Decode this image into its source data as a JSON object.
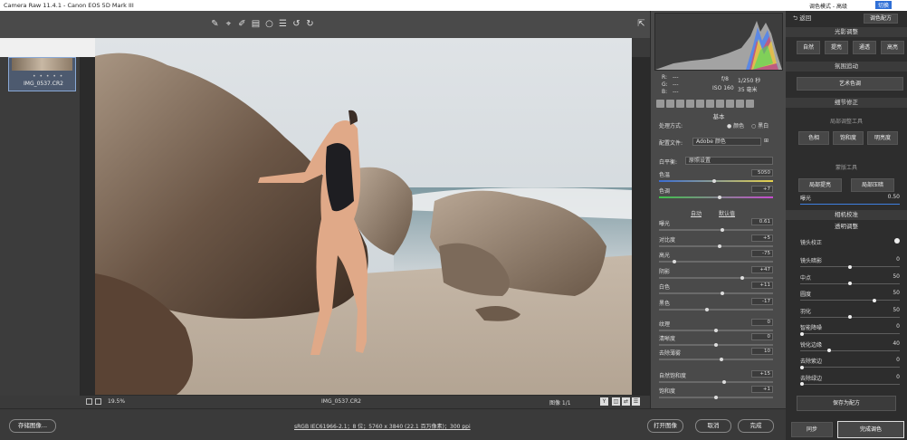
{
  "app": {
    "title": "Camera Raw 11.4.1 - Canon EOS 5D Mark III"
  },
  "filmstrip": {
    "thumb_name": "IMG_0537.CR2",
    "stars": "• • • • •"
  },
  "canvas": {
    "zoom": "19.5%",
    "filename": "IMG_0537.CR2",
    "image_count": "图像 1/1"
  },
  "bottom": {
    "save_label": "存储图像...",
    "workflow_link": "sRGB IEC61966-2.1；8 位；5760 x 3840 (22.1 百万像素)；300 ppi",
    "open_label": "打开图像",
    "cancel_label": "取消",
    "done_label": "完成"
  },
  "exif": {
    "r": "R:",
    "g": "G:",
    "b": "B:",
    "dash": "---",
    "aperture": "f/8",
    "shutter": "1/250 秒",
    "iso": "ISO 160",
    "focal": "35 毫米"
  },
  "basic": {
    "title": "基本",
    "treatment_label": "处理方式:",
    "color_label": "颜色",
    "bw_label": "黑白",
    "profile_label": "配置文件:",
    "profile_value": "Adobe 颜色",
    "wb_label": "白平衡:",
    "wb_value": "原照设置",
    "temp_label": "色温",
    "temp_value": "5050",
    "temp_pos": 0.48,
    "tint_label": "色调",
    "tint_value": "+7",
    "tint_pos": 0.53,
    "auto_label": "自动",
    "default_label": "默认值",
    "sliders": [
      {
        "label": "曝光",
        "value": "0.61",
        "pos": 0.56
      },
      {
        "label": "对比度",
        "value": "+5",
        "pos": 0.53
      },
      {
        "label": "高光",
        "value": "-75",
        "pos": 0.12
      },
      {
        "label": "阴影",
        "value": "+47",
        "pos": 0.74
      },
      {
        "label": "白色",
        "value": "+11",
        "pos": 0.56
      },
      {
        "label": "黑色",
        "value": "-17",
        "pos": 0.42
      }
    ],
    "presence": [
      {
        "label": "纹理",
        "value": "0",
        "pos": 0.5
      },
      {
        "label": "清晰度",
        "value": "0",
        "pos": 0.5
      },
      {
        "label": "去除薄雾",
        "value": "10",
        "pos": 0.55
      }
    ],
    "sat": [
      {
        "label": "自然饱和度",
        "value": "+15",
        "pos": 0.57
      },
      {
        "label": "饱和度",
        "value": "+1",
        "pos": 0.5
      }
    ]
  },
  "plugin": {
    "top_title": "调色模式 - 高级",
    "top_badge": "切换",
    "back_label": "返回",
    "config_label": "调色配方",
    "sec1": "光影调整",
    "sec1_buttons": [
      "自然",
      "提亮",
      "通透",
      "高亮"
    ],
    "sec2": "氛围追动",
    "art_label": "艺术色调",
    "sec3": "细节修正",
    "local_label": "局部调整工具",
    "local_buttons": [
      "色相",
      "饱和度",
      "明亮度"
    ],
    "mask_label": "蒙版工具",
    "mask_buttons": [
      "局部提亮",
      "局部压暗"
    ],
    "exposure_label": "曝光",
    "exposure_value": "0.50",
    "sec4": "相机校准",
    "sec5": "透明调整",
    "lens_label": "镜头校正",
    "rows": [
      {
        "label": "镜头暗影",
        "value": "0",
        "pos": 0.5
      },
      {
        "label": "中点",
        "value": "50",
        "pos": 0.5
      },
      {
        "label": "圆度",
        "value": "50",
        "pos": 0.75
      },
      {
        "label": "羽化",
        "value": "50",
        "pos": 0.5
      },
      {
        "label": "智能降噪",
        "value": "0",
        "pos": 0.0
      },
      {
        "label": "锐化边缘",
        "value": "40",
        "pos": 0.28
      },
      {
        "label": "去除紫边",
        "value": "0",
        "pos": 0.0
      },
      {
        "label": "去除绿边",
        "value": "0",
        "pos": 0.0
      }
    ],
    "save_preset": "保存为配方",
    "sync_label": "同步",
    "finish_label": "完成调色"
  },
  "colors": {
    "accent": "#8aa9d6",
    "panel": "#4a4a4a",
    "plugin_bg": "#2d2d2d"
  }
}
